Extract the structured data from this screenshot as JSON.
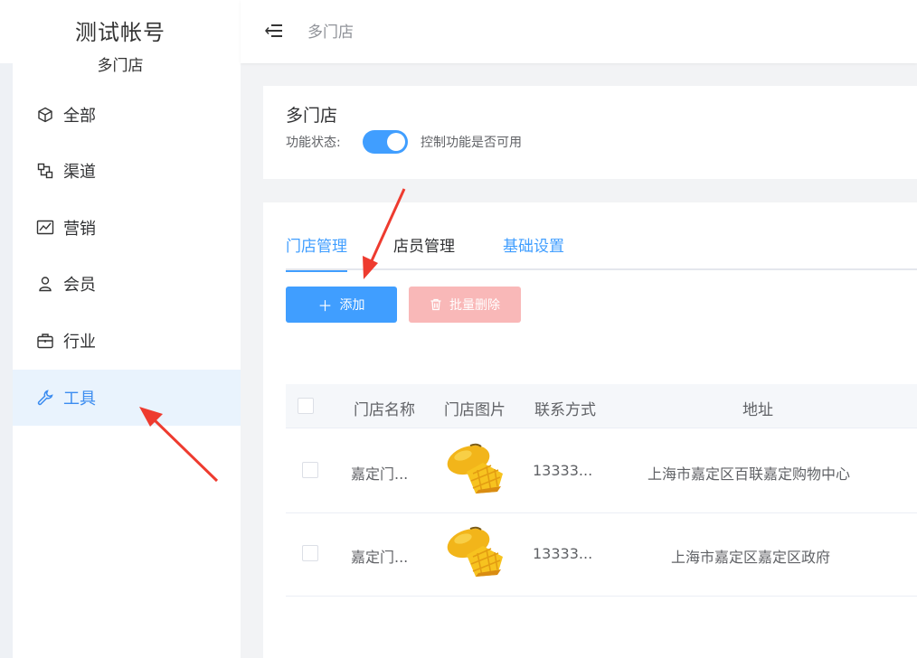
{
  "sidebar": {
    "account_name": "测试帐号",
    "store": "多门店",
    "items": [
      {
        "label": "全部",
        "icon": "cube-icon"
      },
      {
        "label": "渠道",
        "icon": "channel-icon"
      },
      {
        "label": "营销",
        "icon": "chart-icon"
      },
      {
        "label": "会员",
        "icon": "user-icon"
      },
      {
        "label": "行业",
        "icon": "briefcase-icon"
      },
      {
        "label": "工具",
        "icon": "wrench-icon",
        "active": true
      }
    ]
  },
  "topbar": {
    "title": "多门店"
  },
  "feature": {
    "title": "多门店",
    "status_label": "功能状态:",
    "switch_on": true,
    "description": "控制功能是否可用"
  },
  "tabs": [
    {
      "label": "门店管理",
      "active": true
    },
    {
      "label": "店员管理"
    },
    {
      "label": "基础设置"
    }
  ],
  "buttons": {
    "add": "添加",
    "batch_delete": "批量删除"
  },
  "table": {
    "columns": [
      "门店名称",
      "门店图片",
      "联系方式",
      "地址"
    ],
    "rows": [
      {
        "name": "嘉定门...",
        "phone": "13333...",
        "address": "上海市嘉定区百联嘉定购物中心"
      },
      {
        "name": "嘉定门...",
        "phone": "13333...",
        "address": "上海市嘉定区嘉定区政府"
      }
    ]
  },
  "colors": {
    "accent": "#409eff",
    "danger_light": "#f9b8b8",
    "annotation_arrow": "#ee3b2f"
  }
}
